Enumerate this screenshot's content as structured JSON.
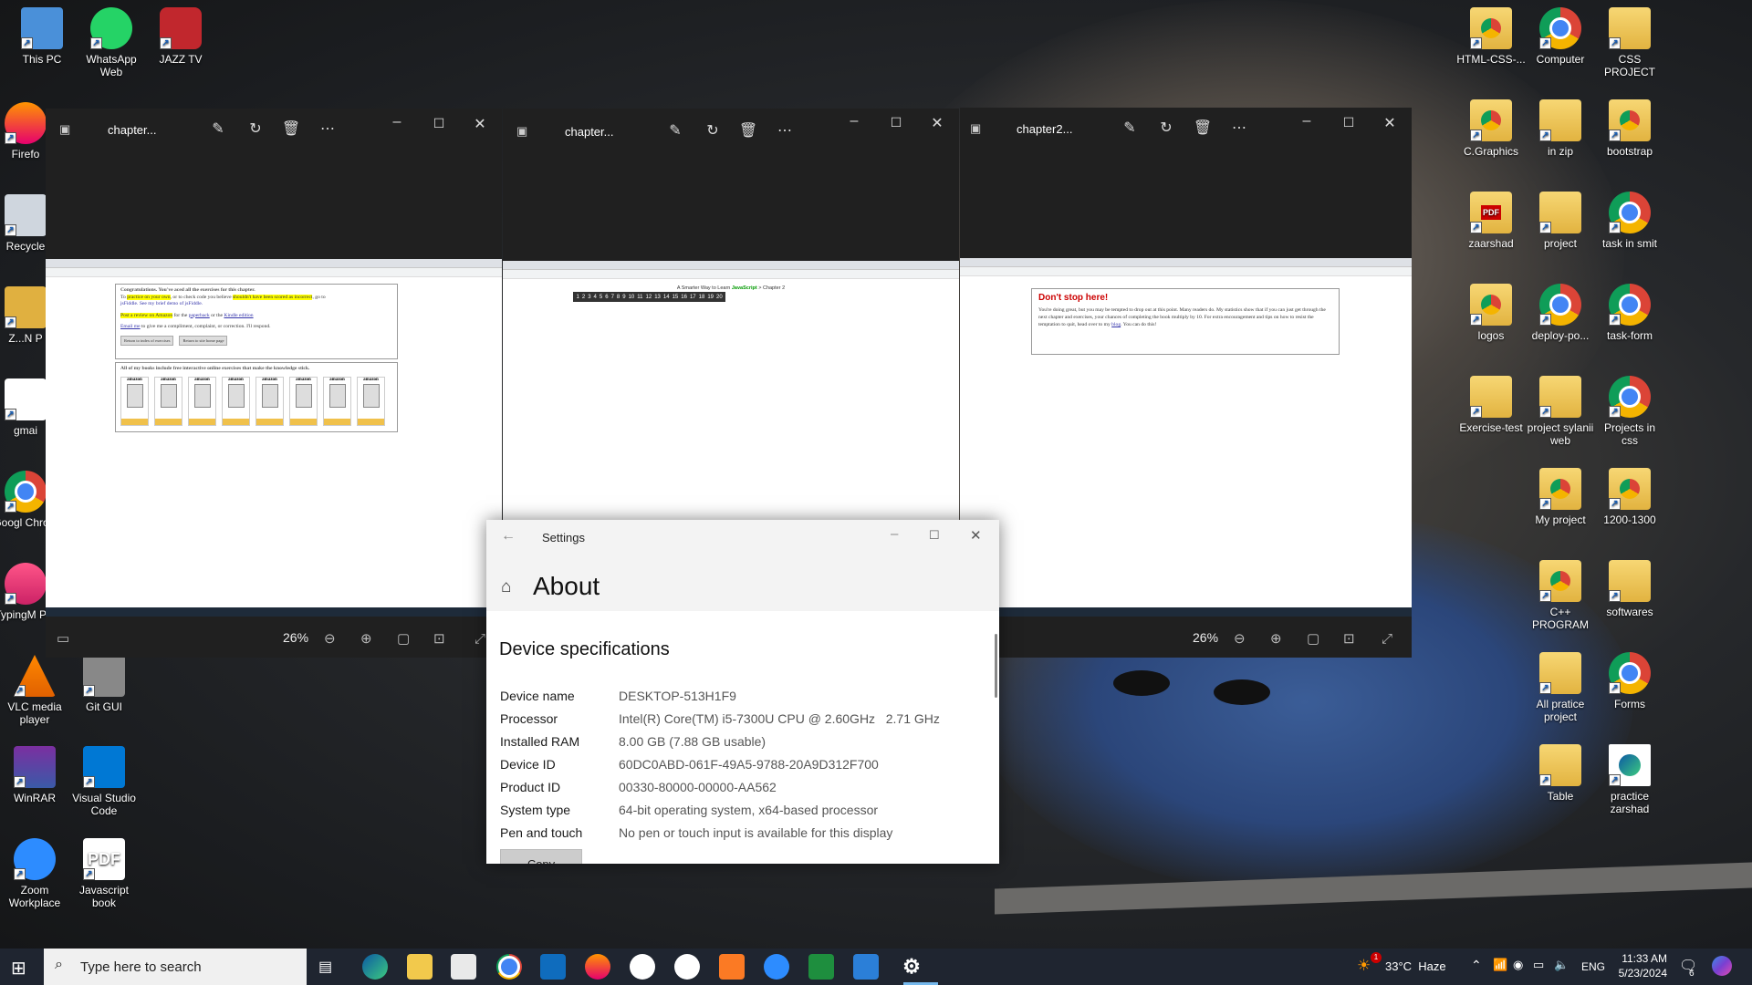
{
  "desktop_left": [
    {
      "label": "This PC",
      "icon": "this-pc-icon"
    },
    {
      "label": "WhatsApp Web",
      "icon": "whatsapp-icon"
    },
    {
      "label": "JAZZ TV",
      "icon": "jazz-tv-icon"
    },
    {
      "label": "Firefo",
      "icon": "firefox-icon"
    },
    {
      "label": "Recycle",
      "icon": "recycle-bin-icon"
    },
    {
      "label": "Z...N P",
      "icon": "folder-icon"
    },
    {
      "label": "gmai",
      "icon": "gmail-icon"
    },
    {
      "label": "Googl Chrom",
      "icon": "chrome-icon"
    },
    {
      "label": "TypingM Pro",
      "icon": "typingmaster-icon"
    },
    {
      "label": "VLC media player",
      "icon": "vlc-icon"
    },
    {
      "label": "Git GUI",
      "icon": "git-gui-icon"
    },
    {
      "label": "WinRAR",
      "icon": "winrar-icon"
    },
    {
      "label": "Visual Studio Code",
      "icon": "vscode-icon"
    },
    {
      "label": "Zoom Workplace",
      "icon": "zoom-icon"
    },
    {
      "label": "Javascript book",
      "icon": "pdf-icon"
    }
  ],
  "desktop_right": [
    {
      "label": "HTML-CSS-...",
      "icon": "chrome-doc-icon"
    },
    {
      "label": "Computer",
      "icon": "chrome-icon"
    },
    {
      "label": "CSS PROJECT",
      "icon": "folder-icon"
    },
    {
      "label": "C.Graphics",
      "icon": "chrome-doc-icon"
    },
    {
      "label": "in zip",
      "icon": "folder-icon"
    },
    {
      "label": "bootstrap",
      "icon": "chrome-doc-icon"
    },
    {
      "label": "zaarshad",
      "icon": "pdf-folder-icon"
    },
    {
      "label": "project",
      "icon": "folder-icon"
    },
    {
      "label": "task in smit",
      "icon": "chrome-icon"
    },
    {
      "label": "logos",
      "icon": "chrome-doc-icon"
    },
    {
      "label": "deploy-po...",
      "icon": "chrome-icon"
    },
    {
      "label": "task-form",
      "icon": "chrome-icon"
    },
    {
      "label": "Exercise-test",
      "icon": "folder-icon"
    },
    {
      "label": "project sylanii web",
      "icon": "folder-icon"
    },
    {
      "label": "Projects in css",
      "icon": "chrome-icon"
    },
    {
      "label": "My project",
      "icon": "chrome-doc-icon"
    },
    {
      "label": "1200-1300",
      "icon": "chrome-doc-icon"
    },
    {
      "label": "C++ PROGRAM",
      "icon": "chrome-doc-icon"
    },
    {
      "label": "softwares",
      "icon": "folder-icon"
    },
    {
      "label": "All pratice project",
      "icon": "folder-icon"
    },
    {
      "label": "Forms",
      "icon": "chrome-icon"
    },
    {
      "label": "Table",
      "icon": "folder-icon"
    },
    {
      "label": "practice zarshad",
      "icon": "edge-doc-icon"
    }
  ],
  "photo_windows": [
    {
      "title": "chapter...",
      "zoom": "26%"
    },
    {
      "title": "chapter...",
      "zoom": ""
    },
    {
      "title": "chapter2...",
      "zoom": "26%"
    }
  ],
  "shot1": {
    "congrats": "Congratulations. You've aced all the exercises for this chapter.",
    "line1a": "To ",
    "line1b": "practice on your own",
    "line1c": ", or to check code you believe ",
    "line1d": "shouldn't have been scored as incorrect",
    "line1e": ", go to",
    "line2": "jsFiddle. See my brief demo of jsFiddle.",
    "review_a": "Post a review on Amazon",
    "review_b": " for the ",
    "review_c": "paperback",
    "review_d": " or the ",
    "review_e": "Kindle edition",
    "email_a": "Email me",
    "email_b": " to give me a compliment, complaint, or correction. I'll respond.",
    "btn1": "Return to index of exercises",
    "btn2": "Return to site home page",
    "books_heading": "All of my books include free interactive online exercises that make the knowledge stick.",
    "book_brand": "amazon"
  },
  "shot2": {
    "heading_a": "A Smarter Way to Learn ",
    "heading_b": "JavaScript",
    "heading_c": " > Chapter 2",
    "pages": [
      "1",
      "2",
      "3",
      "4",
      "5",
      "6",
      "7",
      "8",
      "9",
      "10",
      "11",
      "12",
      "13",
      "14",
      "15",
      "16",
      "17",
      "18",
      "19",
      "20"
    ]
  },
  "shot3": {
    "title": "Don't stop here!",
    "body": "You're doing great, but you may be tempted to drop out at this point. Many readers do. My statistics show that if you can just get through the next chapter and exercises, your chances of completing the book multiply by 10. For extra encouragement and tips on how to resist the temptation to quit, head over to my ",
    "link": "blog",
    "tail": ". You can do this!"
  },
  "settings": {
    "window_title": "Settings",
    "page_title": "About",
    "section": "Device specifications",
    "specs": [
      {
        "label": "Device name",
        "value": "DESKTOP-513H1F9"
      },
      {
        "label": "Processor",
        "value": "Intel(R) Core(TM) i5-7300U CPU @ 2.60GHz   2.71 GHz"
      },
      {
        "label": "Installed RAM",
        "value": "8.00 GB (7.88 GB usable)"
      },
      {
        "label": "Device ID",
        "value": "60DC0ABD-061F-49A5-9788-20A9D312F700"
      },
      {
        "label": "Product ID",
        "value": "00330-80000-00000-AA562"
      },
      {
        "label": "System type",
        "value": "64-bit operating system, x64-based processor"
      },
      {
        "label": "Pen and touch",
        "value": "No pen or touch input is available for this display"
      }
    ],
    "copy_button": "Copy"
  },
  "taskbar": {
    "search_placeholder": "Type here to search",
    "weather": "33°C  Haze",
    "lang": "ENG",
    "time": "11:33 AM",
    "date": "5/23/2024",
    "notif_count": "6",
    "weather_badge": "1"
  }
}
